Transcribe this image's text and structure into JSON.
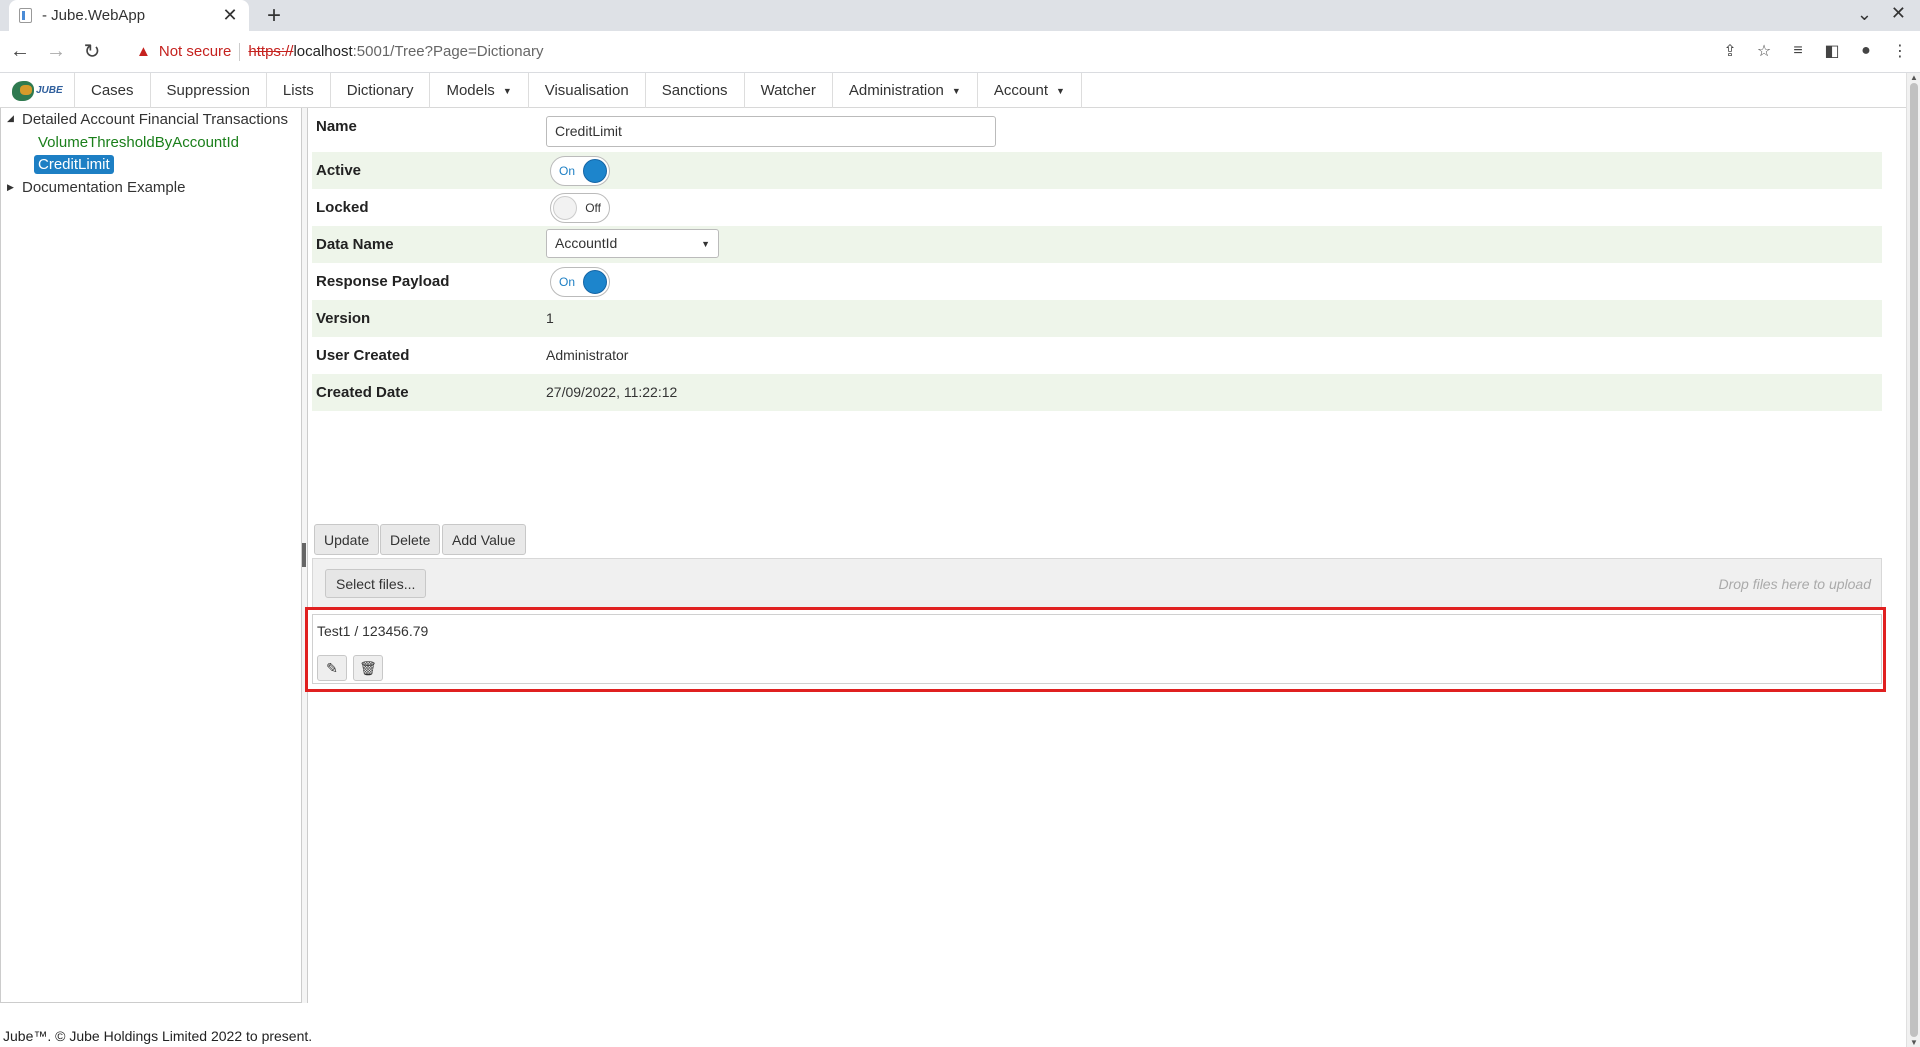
{
  "browser": {
    "tab_title": "- Jube.WebApp",
    "tab_close": "✕",
    "new_tab": "+",
    "not_secure": "Not secure",
    "url_scheme": "https://",
    "url_host": "localhost",
    "url_rest": ":5001/Tree?Page=Dictionary"
  },
  "menu": {
    "logo_text": "JUBE",
    "items": [
      "Cases",
      "Suppression",
      "Lists",
      "Dictionary",
      "Models",
      "Visualisation",
      "Sanctions",
      "Watcher",
      "Administration",
      "Account"
    ]
  },
  "tree": {
    "group1": "Detailed Account Financial Transactions",
    "leaf1": "VolumeThresholdByAccountId",
    "leaf2": "CreditLimit",
    "group2": "Documentation Example"
  },
  "form": {
    "name_label": "Name",
    "name_value": "CreditLimit",
    "active_label": "Active",
    "active_state": "On",
    "locked_label": "Locked",
    "locked_state": "Off",
    "data_name_label": "Data Name",
    "data_name_value": "AccountId",
    "response_payload_label": "Response Payload",
    "response_payload_state": "On",
    "version_label": "Version",
    "version_value": "1",
    "user_created_label": "User Created",
    "user_created_value": "Administrator",
    "created_date_label": "Created Date",
    "created_date_value": "27/09/2022, 11:22:12"
  },
  "buttons": {
    "update": "Update",
    "delete": "Delete",
    "add_value": "Add Value"
  },
  "upload": {
    "select_files": "Select files...",
    "drop_hint": "Drop files here to upload"
  },
  "values": {
    "entry": "Test1 / 123456.79"
  },
  "footer": {
    "text": "Jube™. © Jube Holdings Limited 2022 to present."
  },
  "colors": {
    "accent": "#1d7fc4",
    "row_shade": "#eef5ea",
    "tree_leaf": "#1a7f1a",
    "highlight": "#e02020"
  }
}
